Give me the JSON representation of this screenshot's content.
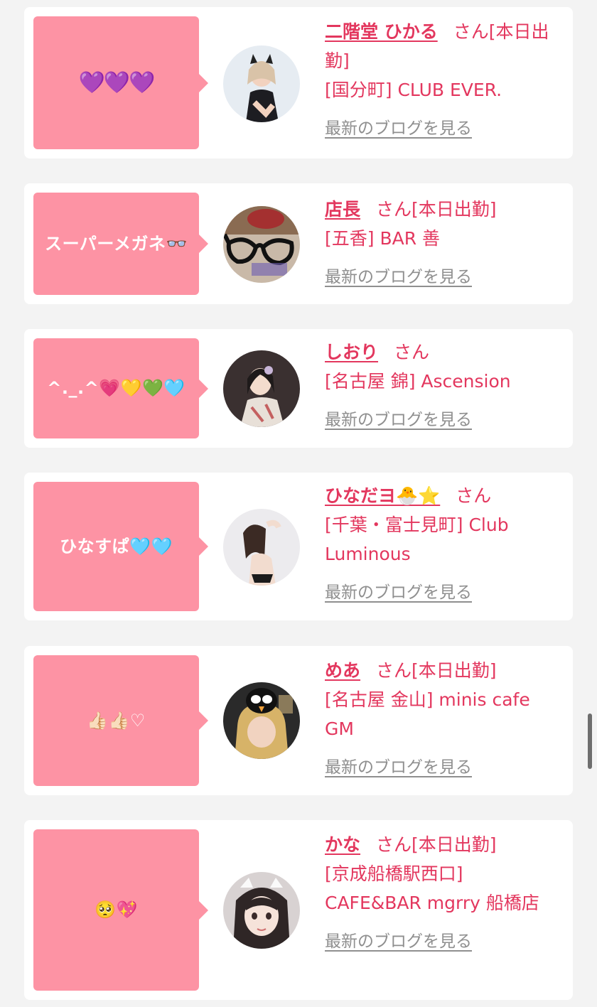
{
  "cards": [
    {
      "bubble": "💜💜💜",
      "name": "二階堂 ひかる",
      "san": "さん",
      "attend": "[本日出勤]",
      "shop": "[国分町] CLUB EVER.",
      "blog": "最新のブログを見る",
      "avatar_icon": "avatar-catgirl"
    },
    {
      "bubble": "スーパーメガネ👓",
      "name": "店長",
      "san": "さん",
      "attend": "[本日出勤]",
      "shop": "[五香] BAR 善",
      "blog": "最新のブログを見る",
      "avatar_icon": "avatar-glasses"
    },
    {
      "bubble": "^._.^💗💛💚🩵",
      "name": "しおり",
      "san": "さん",
      "attend": "",
      "shop": "[名古屋 錦] Ascension",
      "blog": "最新のブログを見る",
      "avatar_icon": "avatar-kimono"
    },
    {
      "bubble": "ひなすぱ🩵🩵",
      "name": "ひなだヨ🐣⭐",
      "san": "さん",
      "attend": "",
      "shop": "[千葉・富士見町] Club Luminous",
      "blog": "最新のブログを見る",
      "avatar_icon": "avatar-woman"
    },
    {
      "bubble": "👍🏻👍🏻♡",
      "name": "めあ",
      "san": "さん",
      "attend": "[本日出勤]",
      "shop": "[名古屋 金山] minis cafe GM",
      "blog": "最新のブログを見る",
      "avatar_icon": "avatar-blonde"
    },
    {
      "bubble": "🥺💖",
      "name": "かな",
      "san": "さん",
      "attend": "[本日出勤]",
      "shop": "[京成船橋駅西口] CAFE&BAR mgrry 船橋店",
      "blog": "最新のブログを見る",
      "avatar_icon": "avatar-maid"
    }
  ],
  "colors": {
    "accent": "#e3375e",
    "bubble": "#fd93a4",
    "link_gray": "#8f8f8f",
    "background": "#f3f3f3"
  }
}
